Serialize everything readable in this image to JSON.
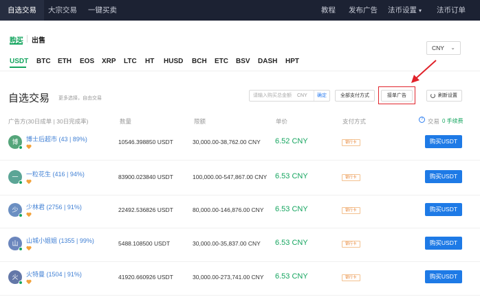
{
  "nav": {
    "left": [
      "自选交易",
      "大宗交易",
      "一键买卖"
    ],
    "right": [
      "教程",
      "发布广告",
      "法币设置",
      "法币订单"
    ]
  },
  "trade_side": {
    "buy": "购买",
    "sell": "出售"
  },
  "currency": {
    "selected": "CNY"
  },
  "coins": [
    "USDT",
    "BTC",
    "ETH",
    "EOS",
    "XRP",
    "LTC",
    "HT",
    "HUSD",
    "BCH",
    "ETC",
    "BSV",
    "DASH",
    "HPT"
  ],
  "section": {
    "title": "自选交易",
    "subtitle": "更多选择，自由交易",
    "amount_placeholder": "请输入购买总金额",
    "amount_unit": "CNY",
    "confirm": "确定",
    "all_payment": "全部支付方式",
    "order_ad": "接单广告",
    "refresh": "刷新设置"
  },
  "table": {
    "headers": {
      "merchant": "广告方(30日成单 | 30日完成率)",
      "qty": "数量",
      "limit": "限额",
      "price": "单价",
      "pay": "支付方式",
      "trade": "交易",
      "fee": "0 手续费"
    },
    "rows": [
      {
        "avatar": "博",
        "avatar_color": "#55a57a",
        "merchant": "博士后超市 (43 | 89%)",
        "qty": "10546.398850 USDT",
        "limit": "30,000.00-38,762.00 CNY",
        "price": "6.52 CNY",
        "pay": "银行卡",
        "action": "购买USDT"
      },
      {
        "avatar": "一",
        "avatar_color": "#5ba596",
        "merchant": "一粒花生 (416 | 94%)",
        "qty": "83900.023840 USDT",
        "limit": "100,000.00-547,867.00 CNY",
        "price": "6.53 CNY",
        "pay": "银行卡",
        "action": "购买USDT"
      },
      {
        "avatar": "少",
        "avatar_color": "#6b8fc2",
        "merchant": "少林君 (2756 | 91%)",
        "qty": "22492.536826 USDT",
        "limit": "80,000.00-146,876.00 CNY",
        "price": "6.53 CNY",
        "pay": "银行卡",
        "action": "购买USDT"
      },
      {
        "avatar": "山",
        "avatar_color": "#6b86bd",
        "merchant": "山城小姐姐 (1355 | 99%)",
        "qty": "5488.108500 USDT",
        "limit": "30,000.00-35,837.00 CNY",
        "price": "6.53 CNY",
        "pay": "银行卡",
        "action": "购买USDT"
      },
      {
        "avatar": "火",
        "avatar_color": "#6377a8",
        "merchant": "火特曼 (1504 | 91%)",
        "qty": "41920.660926 USDT",
        "limit": "30,000.00-273,741.00 CNY",
        "price": "6.53 CNY",
        "pay": "银行卡",
        "action": "购买USDT"
      }
    ]
  },
  "colors": {
    "accent_green": "#15a55f",
    "button_blue": "#1e7ae6",
    "nav_bg": "#1c2233",
    "annotation_red": "#e0222a"
  }
}
